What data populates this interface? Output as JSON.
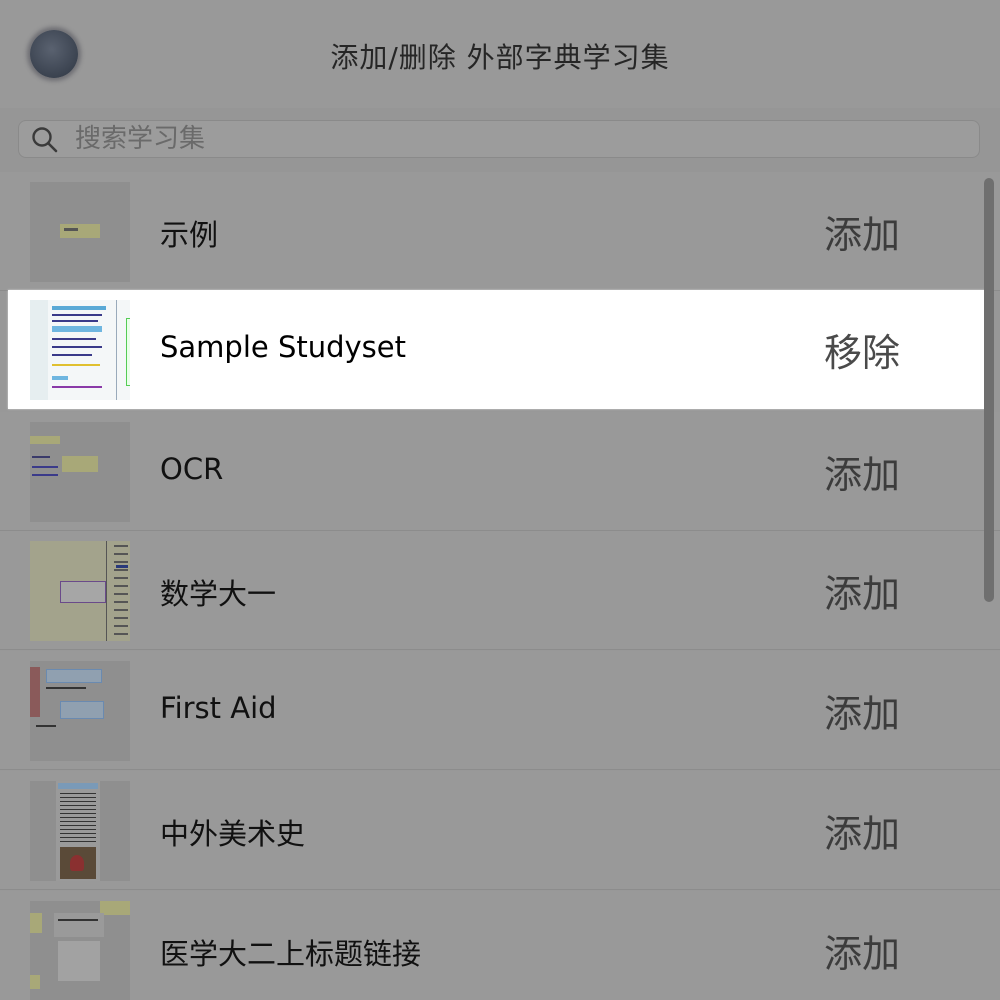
{
  "header": {
    "title": "添加/删除 外部字典学习集",
    "back_icon": "back-button-icon"
  },
  "search": {
    "placeholder": "搜索学习集",
    "value": "",
    "icon": "search-icon"
  },
  "studysets": [
    {
      "name": "示例",
      "action": "添加",
      "selected": false
    },
    {
      "name": "Sample Studyset",
      "action": "移除",
      "selected": true
    },
    {
      "name": "OCR",
      "action": "添加",
      "selected": false
    },
    {
      "name": "数学大一",
      "action": "添加",
      "selected": false
    },
    {
      "name": "First Aid",
      "action": "添加",
      "selected": false
    },
    {
      "name": "中外美术史",
      "action": "添加",
      "selected": false
    },
    {
      "name": "医学大二上标题链接",
      "action": "添加",
      "selected": false
    }
  ],
  "colors": {
    "overlay": "#999999",
    "selected_row": "#ffffff",
    "action_text": "#3c3c3c",
    "label_text": "#111111"
  }
}
